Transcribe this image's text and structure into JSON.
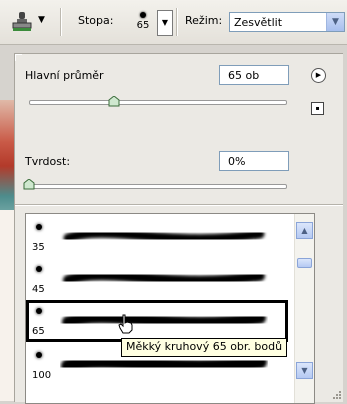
{
  "toolbar": {
    "tool_icon": "stamp-icon",
    "stopa_label": "Stopa:",
    "brush_size": "65",
    "rezim_label": "Režim:",
    "rezim_value": "Zesvětlit"
  },
  "panel": {
    "diameter_label": "Hlavní průměr",
    "diameter_value": "65 ob",
    "diameter_slider_fraction": 0.32,
    "hardness_label": "Tvrdost:",
    "hardness_value": "0%",
    "hardness_slider_fraction": 0.0,
    "menu_icon": "play-icon",
    "new_preset_icon": "new-preset-icon"
  },
  "brush_list": {
    "items": [
      {
        "size": "35"
      },
      {
        "size": "45"
      },
      {
        "size": "65",
        "selected": true
      },
      {
        "size": "100"
      }
    ]
  },
  "tooltip": {
    "text": "Měkký kruhový 65 obr. bodů"
  }
}
